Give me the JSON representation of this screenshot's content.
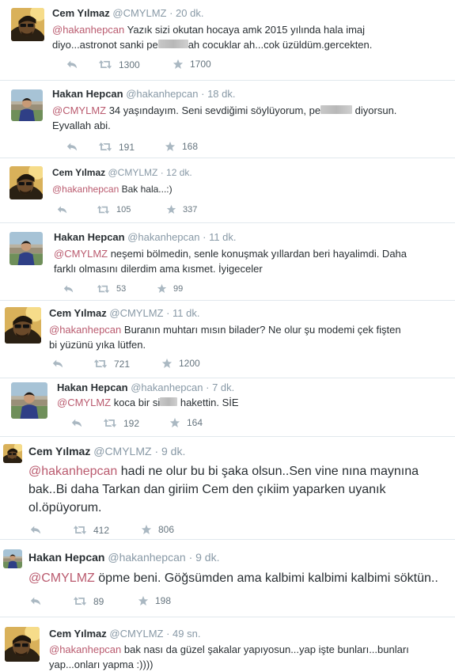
{
  "tweets": [
    {
      "name": "Cem Yılmaz",
      "handle": "@CMYLMZ",
      "time": "· 20 dk.",
      "mention": "@hakanhepcan",
      "line1_rest": " Yazık sizi okutan hocaya amk 2015 yılında hala imaj",
      "line2_a": "diyo...astronot sanki pe",
      "line2_b": "ah cocuklar ah...cok üzüldüm.gercekten.",
      "retweets": "1300",
      "favorites": "1700"
    },
    {
      "name": "Hakan Hepcan",
      "handle": "@hakanhepcan",
      "time": "· 18 dk.",
      "mention": "@CMYLMZ",
      "line1_rest": " 34 yaşındayım. Seni sevdiğimi söylüyorum, pe",
      "line1_b": " diyorsun.",
      "line2": "Eyvallah abi.",
      "retweets": "191",
      "favorites": "168"
    },
    {
      "name": "Cem Yılmaz",
      "handle": "@CMYLMZ",
      "time": "· 12 dk.",
      "mention": "@hakanhepcan",
      "line1_rest": " Bak hala...:)",
      "retweets": "105",
      "favorites": "337"
    },
    {
      "name": "Hakan Hepcan",
      "handle": "@hakanhepcan",
      "time": "· 11 dk.",
      "mention": "@CMYLMZ",
      "line1_rest": " neşemi bölmedin, senle konuşmak yıllardan beri hayalimdi. Daha",
      "line2": "farklı olmasını dilerdim ama kısmet. İyigeceler",
      "retweets": "53",
      "favorites": "99"
    },
    {
      "name": "Cem Yılmaz",
      "handle": "@CMYLMZ",
      "time": "· 11 dk.",
      "mention": "@hakanhepcan",
      "line1_rest": " Buranın muhtarı mısın bilader? Ne olur şu modemi çek fişten",
      "line2": "bi yüzünü yıka lütfen.",
      "retweets": "721",
      "favorites": "1200"
    },
    {
      "name": "Hakan Hepcan",
      "handle": "@hakanhepcan",
      "time": "· 7 dk.",
      "mention": "@CMYLMZ",
      "line1_rest": " koca bir si",
      "line1_b": " hakettin. SİE",
      "retweets": "192",
      "favorites": "164"
    },
    {
      "name": "Cem Yılmaz",
      "handle": "@CMYLMZ",
      "time": "· 9 dk.",
      "mention": "@hakanhepcan",
      "line1_rest": " hadi ne olur bu bi şaka olsun..Sen vine nına maynına",
      "line2": "bak..Bi daha Tarkan dan giriim Cem den çıkiim yaparken uyanık",
      "line3": "ol.öpüyorum.",
      "retweets": "412",
      "favorites": "806"
    },
    {
      "name": "Hakan Hepcan",
      "handle": "@hakanhepcan",
      "time": "· 9 dk.",
      "mention": "@CMYLMZ",
      "line1_rest": " öpme beni. Göğsümden ama kalbimi kalbimi kalbimi söktün..",
      "retweets": "89",
      "favorites": "198"
    },
    {
      "name": "Cem Yılmaz",
      "handle": "@CMYLMZ",
      "time": "· 49 sn.",
      "mention": "@hakanhepcan",
      "line1_rest": " bak nası da güzel şakalar yapıyosun...yap işte bunları...bunları",
      "line2": "yap...onları yapma :))))"
    }
  ],
  "icons": {
    "reply": "reply-arrow-icon",
    "retweet": "retweet-icon",
    "favorite": "star-icon"
  },
  "colors": {
    "mention": "#ba5b6f",
    "muted": "#8899a6",
    "separator": "#e1e8ed"
  }
}
